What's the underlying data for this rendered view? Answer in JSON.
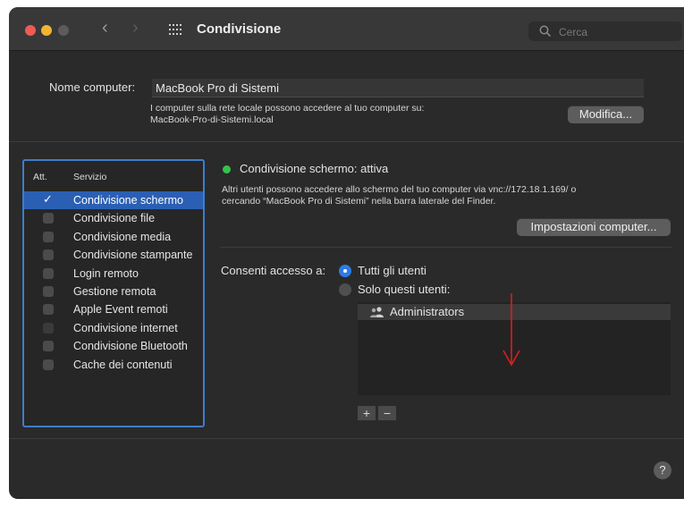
{
  "window": {
    "title": "Condivisione",
    "search_placeholder": "Cerca"
  },
  "computer_name": {
    "label": "Nome computer:",
    "value": "MacBook Pro di Sistemi",
    "info_line1": "I computer sulla rete locale possono accedere al tuo computer su:",
    "info_line2": "MacBook-Pro-di-Sistemi.local",
    "edit_button": "Modifica..."
  },
  "services": {
    "header_on": "Att.",
    "header_service": "Servizio",
    "items": [
      {
        "label": "Condivisione schermo",
        "checked": true,
        "selected": true
      },
      {
        "label": "Condivisione file",
        "checked": false
      },
      {
        "label": "Condivisione media",
        "checked": false
      },
      {
        "label": "Condivisione stampante",
        "checked": false
      },
      {
        "label": "Login remoto",
        "checked": false
      },
      {
        "label": "Gestione remota",
        "checked": false
      },
      {
        "label": "Apple Event remoti",
        "checked": false
      },
      {
        "label": "Condivisione internet",
        "checked": false
      },
      {
        "label": "Condivisione Bluetooth",
        "checked": false
      },
      {
        "label": "Cache dei contenuti",
        "checked": false
      }
    ]
  },
  "detail": {
    "status": "Condivisione schermo: attiva",
    "status_color": "#34c34a",
    "desc_line1": "Altri utenti possono accedere allo schermo del tuo computer via vnc://172.18.1.169/ o",
    "desc_line2": "cercando “MacBook Pro di Sistemi” nella barra laterale del Finder.",
    "computer_settings_button": "Impostazioni computer...",
    "access_label": "Consenti accesso a:",
    "radio_all": "Tutti gli utenti",
    "radio_only": "Solo questi utenti:",
    "users": [
      "Administrators"
    ],
    "add_button": "+",
    "remove_button": "−"
  },
  "help_button": "?",
  "colors": {
    "accent": "#2b5fb4",
    "focus_ring": "#3f7dc9",
    "annotation_arrow": "#d62020"
  }
}
